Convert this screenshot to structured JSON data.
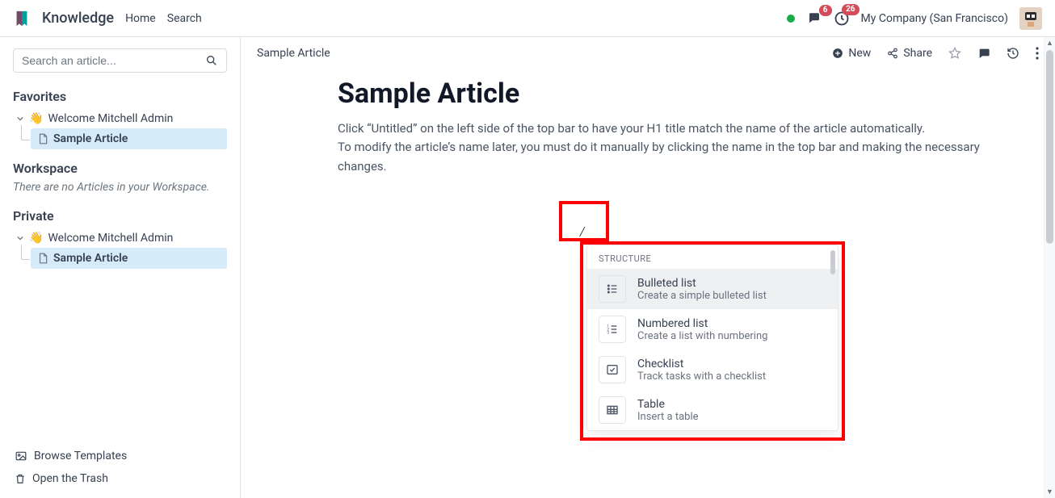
{
  "nav": {
    "app": "Knowledge",
    "home": "Home",
    "search": "Search",
    "msg_count": "6",
    "activity_count": "26",
    "company": "My Company (San Francisco)"
  },
  "sidebar": {
    "search_placeholder": "Search an article...",
    "favorites": "Favorites",
    "fav_item": "Welcome Mitchell Admin",
    "fav_child": "Sample Article",
    "workspace": "Workspace",
    "workspace_empty": "There are no Articles in your Workspace.",
    "private": "Private",
    "priv_item": "Welcome Mitchell Admin",
    "priv_child": "Sample Article",
    "browse": "Browse Templates",
    "trash": "Open the Trash"
  },
  "toolbar": {
    "breadcrumb": "Sample Article",
    "new": "New",
    "share": "Share"
  },
  "article": {
    "title": "Sample Article",
    "p1": "Click “Untitled” on the left side of the top bar to have your H1 title match the name of the article automatically.",
    "p2": "To modify the article’s name later, you must do it manually by clicking the name in the top bar and making the necessary changes.",
    "slash": "/"
  },
  "popup": {
    "heading": "STRUCTURE",
    "items": [
      {
        "title": "Bulleted list",
        "desc": "Create a simple bulleted list"
      },
      {
        "title": "Numbered list",
        "desc": "Create a list with numbering"
      },
      {
        "title": "Checklist",
        "desc": "Track tasks with a checklist"
      },
      {
        "title": "Table",
        "desc": "Insert a table"
      }
    ]
  }
}
